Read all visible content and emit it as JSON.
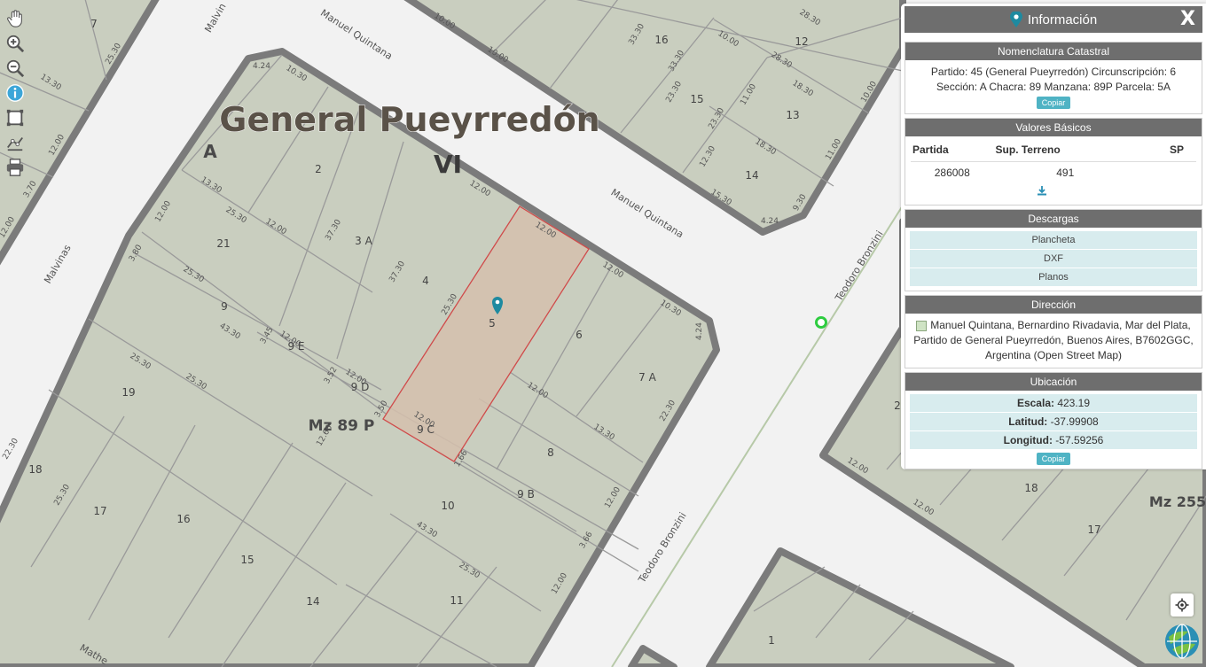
{
  "map": {
    "labels": {
      "city_name": "General Pueyrredón",
      "circ_vi": "VI",
      "sec_a": "A",
      "mz_89p": "Mz 89 P",
      "mz_255": "Mz 255"
    },
    "streets": {
      "manuel_quintana_top": "Manuel Quintana",
      "manuel_quintana_right": "Manuel Quintana",
      "teodoro_bronzini_top": "Teodoro Bronzini",
      "teodoro_bronzini_bottom": "Teodoro Bronzini",
      "malvinas_left": "Malvinas",
      "malvinas_top": "Malvin",
      "mathe": "Mathe"
    },
    "parcels": [
      "2",
      "3 A",
      "4",
      "5",
      "6",
      "7 A",
      "8",
      "9",
      "9 E",
      "9 D",
      "9 C",
      "9 B",
      "10",
      "11",
      "14",
      "15",
      "16",
      "17",
      "18",
      "19",
      "21",
      "7",
      "12",
      "13",
      "14",
      "15",
      "16",
      "18",
      "17",
      "1",
      "2"
    ],
    "dimensions": [
      "4.24",
      "10.30",
      "13.30",
      "25.30",
      "12.00",
      "37.30",
      "12.00",
      "43.30",
      "3.80",
      "12.00",
      "3.45",
      "3.52",
      "3.50",
      "12.66",
      "25.30",
      "25.30",
      "12.00",
      "25.30",
      "12.00",
      "37.30",
      "12.00",
      "25.30",
      "12.00",
      "13.30",
      "22.30",
      "12.00",
      "4.24",
      "10.30",
      "3.66",
      "1.66",
      "12.00",
      "12.00",
      "12.00",
      "10.00",
      "10.00",
      "33.30",
      "33.30",
      "23.30",
      "23.30",
      "12.30",
      "15.30",
      "18.30",
      "18.30",
      "28.30",
      "28.30",
      "10.00",
      "11.00",
      "11.00",
      "10.00",
      "9.30",
      "4.24",
      "13.30",
      "25.30",
      "12.00",
      "3.70",
      "12.00",
      "22.30",
      "25.30",
      "43.30",
      "25.30",
      "12.00",
      "12.00"
    ],
    "colors": {
      "block_fill": "#c9cebf",
      "block_border": "#7b7b7b",
      "street": "#f2f2f2",
      "selected_fill": "#d5bfad",
      "selected_border": "#d04a4a",
      "pin": "#1e8aa0",
      "green_marker": "#2ecc40"
    }
  },
  "toolbar": {
    "tools": [
      "pan-hand-icon",
      "zoom-in-icon",
      "zoom-out-icon",
      "info-icon",
      "select-box-icon",
      "measure-icon",
      "print-icon"
    ]
  },
  "panel": {
    "title": "Información",
    "close_label": "X",
    "nomenclatura": {
      "heading": "Nomenclatura Catastral",
      "text": "Partido: 45 (General Pueyrredón) Circunscripción: 6 Sección: A Chacra: 89 Manzana: 89P Parcela: 5A",
      "copy_label": "Copiar"
    },
    "valores": {
      "heading": "Valores Básicos",
      "col_partida": "Partida",
      "col_sup": "Sup. Terreno",
      "col_sp": "SP",
      "partida": "286008",
      "sup": "491",
      "sp": ""
    },
    "descargas": {
      "heading": "Descargas",
      "items": [
        "Plancheta",
        "DXF",
        "Planos"
      ]
    },
    "direccion": {
      "heading": "Dirección",
      "text": "Manuel Quintana, Bernardino Rivadavia, Mar del Plata, Partido de General Pueyrredón, Buenos Aires, B7602GGC, Argentina (Open Street Map)"
    },
    "ubicacion": {
      "heading": "Ubicación",
      "escala_label": "Escala:",
      "escala": "423.19",
      "latitud_label": "Latitud:",
      "latitud": "-37.99908",
      "longitud_label": "Longitud:",
      "longitud": "-57.59256",
      "copy_label": "Copiar"
    }
  }
}
